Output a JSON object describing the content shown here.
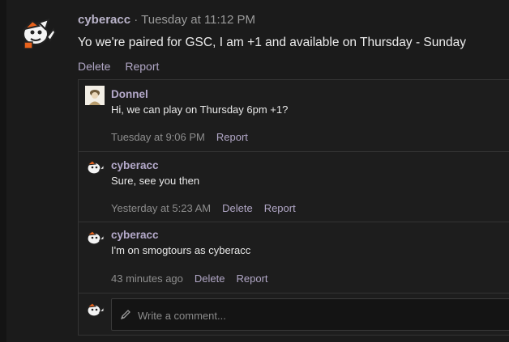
{
  "post": {
    "author": "cyberacc",
    "separator": " · ",
    "time": "Tuesday at 11:12 PM",
    "text": "Yo we're paired for GSC, I am +1 and available on Thursday - Sunday",
    "actions": {
      "delete": "Delete",
      "report": "Report"
    }
  },
  "comments": [
    {
      "author": "Donnel",
      "text": "Hi, we can play on Thursday 6pm +1?",
      "time": "Tuesday at 9:06 PM",
      "report": "Report"
    },
    {
      "author": "cyberacc",
      "text": "Sure, see you then",
      "time": "Yesterday at 5:23 AM",
      "delete": "Delete",
      "report": "Report"
    },
    {
      "author": "cyberacc",
      "text": "I'm on smogtours as cyberacc",
      "time": "43 minutes ago",
      "delete": "Delete",
      "report": "Report"
    }
  ],
  "composer": {
    "placeholder": "Write a comment..."
  },
  "icons": {
    "composer": "pencil-icon"
  }
}
